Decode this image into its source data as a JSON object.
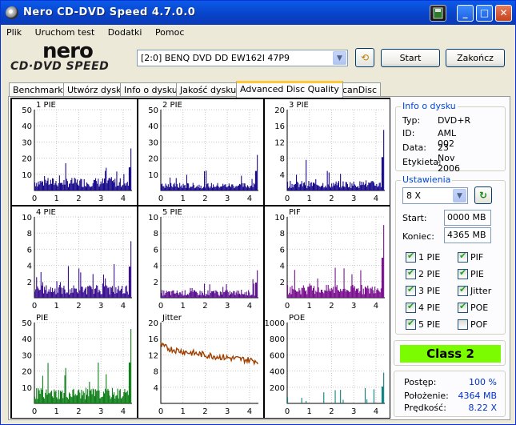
{
  "window": {
    "title": "Nero CD-DVD Speed 4.7.0.0"
  },
  "titlebar_buttons": {
    "minimize": "_",
    "maximize": "□",
    "close": "✕"
  },
  "menu": [
    "Plik",
    "Uruchom test",
    "Dodatki",
    "Pomoc"
  ],
  "logo": {
    "line1": "nero",
    "line2": "CD·DVD SPEED"
  },
  "drive": {
    "selected": "[2:0]  BENQ DVD DD EW162I 47P9"
  },
  "buttons": {
    "start": "Start",
    "end": "Zakończ"
  },
  "tabs": [
    "Benchmark",
    "Utwórz dysk",
    "Info o dysku",
    "Jakość dysku",
    "Advanced Disc Quality",
    "ScanDisc"
  ],
  "active_tab": "Advanced Disc Quality",
  "disc_info": {
    "group_label": "Info o dysku",
    "rows": [
      {
        "key": "Typ:",
        "value": "DVD+R"
      },
      {
        "key": "ID:",
        "value": "AML 002"
      },
      {
        "key": "Data:",
        "value": "23 Nov 2006"
      },
      {
        "key": "Etykieta:",
        "value": "-"
      }
    ]
  },
  "settings": {
    "group_label": "Ustawienia",
    "speed": "8 X",
    "start_label": "Start:",
    "start_value": "0000 MB",
    "end_label": "Koniec:",
    "end_value": "4365 MB",
    "checkboxes": [
      {
        "label": "1 PIE",
        "checked": true
      },
      {
        "label": "PIF",
        "checked": true
      },
      {
        "label": "2 PIE",
        "checked": true
      },
      {
        "label": "PIE",
        "checked": true
      },
      {
        "label": "3 PIE",
        "checked": true
      },
      {
        "label": "Jitter",
        "checked": true
      },
      {
        "label": "4 PIE",
        "checked": true
      },
      {
        "label": "POE",
        "checked": true
      },
      {
        "label": "5 PIE",
        "checked": true
      },
      {
        "label": "POF",
        "checked": false
      }
    ]
  },
  "class": {
    "label": "Class 2",
    "color": "#7cfc00"
  },
  "stats": [
    {
      "key": "Postęp:",
      "value": "100 %"
    },
    {
      "key": "Położenie:",
      "value": "4364 MB"
    },
    {
      "key": "Prędkość:",
      "value": "8.22 X"
    }
  ],
  "chart_data": [
    {
      "type": "bar",
      "title": "1 PIE",
      "ylim": [
        0,
        50
      ],
      "yticks": [
        10,
        20,
        30,
        40,
        50
      ],
      "xticks": [
        0,
        1,
        2,
        3,
        4
      ],
      "xlim": [
        0,
        4.4
      ],
      "color": "#1a0a8c",
      "base": 5,
      "peak": 26
    },
    {
      "type": "bar",
      "title": "2 PIE",
      "ylim": [
        0,
        50
      ],
      "yticks": [
        10,
        20,
        30,
        40,
        50
      ],
      "xticks": [
        0,
        1,
        2,
        3,
        4
      ],
      "xlim": [
        0,
        4.4
      ],
      "color": "#1a0a8c",
      "base": 3,
      "peak": 22
    },
    {
      "type": "bar",
      "title": "3 PIE",
      "ylim": [
        0,
        20
      ],
      "yticks": [
        4,
        8,
        12,
        16,
        20
      ],
      "xticks": [
        0,
        1,
        2,
        3,
        4
      ],
      "xlim": [
        0,
        4.4
      ],
      "color": "#1a0a8c",
      "base": 1.5,
      "peak": 15
    },
    {
      "type": "bar",
      "title": "4 PIE",
      "ylim": [
        0,
        10
      ],
      "yticks": [
        2,
        4,
        6,
        8,
        10
      ],
      "xticks": [
        0,
        1,
        2,
        3,
        4
      ],
      "xlim": [
        0,
        4.4
      ],
      "color": "#3a1090",
      "base": 1,
      "peak": 7
    },
    {
      "type": "bar",
      "title": "5 PIE",
      "ylim": [
        0,
        10
      ],
      "yticks": [
        2,
        4,
        6,
        8,
        10
      ],
      "xticks": [
        0,
        1,
        2,
        3,
        4
      ],
      "xlim": [
        0,
        4.4
      ],
      "color": "#5a1090",
      "base": 0.6,
      "peak": 3.4
    },
    {
      "type": "bar",
      "title": "PIF",
      "ylim": [
        0,
        10
      ],
      "yticks": [
        2,
        4,
        6,
        8,
        10
      ],
      "xticks": [
        0,
        1,
        2,
        3,
        4
      ],
      "xlim": [
        0,
        4.4
      ],
      "color": "#7a1090",
      "base": 1,
      "peak": 9
    },
    {
      "type": "bar",
      "title": "PIE",
      "ylim": [
        0,
        50
      ],
      "yticks": [
        10,
        20,
        30,
        40,
        50
      ],
      "xticks": [
        0,
        1,
        2,
        3,
        4
      ],
      "xlim": [
        0,
        4.4
      ],
      "color": "#10801a",
      "base": 6,
      "peak": 46
    },
    {
      "type": "line",
      "title": "Jitter",
      "ylim": [
        0,
        20
      ],
      "yticks": [
        4,
        8,
        12,
        16,
        20
      ],
      "xticks": [
        0,
        1,
        2,
        3,
        4
      ],
      "xlim": [
        0,
        4.4
      ],
      "color": "#a04000",
      "start": 14.5,
      "end": 10.5
    },
    {
      "type": "bar",
      "title": "POE",
      "ylim": [
        0,
        1000
      ],
      "yticks": [
        200,
        400,
        600,
        800,
        1000
      ],
      "xticks": [
        0,
        1,
        2,
        3,
        4
      ],
      "xlim": [
        0,
        4.4
      ],
      "color": "#108080",
      "base": 0,
      "peak": 380
    }
  ]
}
